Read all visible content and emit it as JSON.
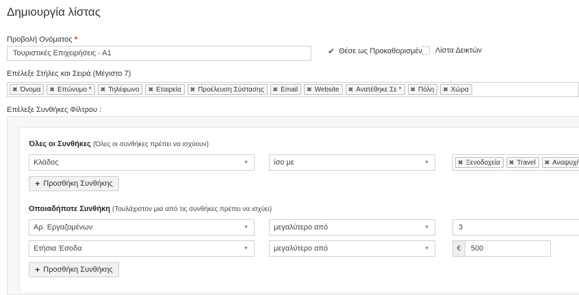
{
  "page": {
    "title": "Δημιουργία λίστας"
  },
  "name_field": {
    "label": "Προβολή Ονόματος",
    "required_mark": "*",
    "value": "Τουριστικές Επιχειρήσεις - Α1"
  },
  "options": {
    "default_label": "Θέσε ως Προκαθορισμένο",
    "default_checked": true,
    "index_label": "Λίστα Δεικτών",
    "index_checked": false
  },
  "columns": {
    "label": "Επέλεξε Στήλες και Σειρά (Μέγιστο 7)",
    "tags": [
      "Όνομα",
      "Επώνυμο *",
      "Τηλέφωνο",
      "Εταιρεία",
      "Προέλευση Σύστασης",
      "Email",
      "Website",
      "Ανατέθηκε Σε *",
      "Πόλη",
      "Χώρα"
    ]
  },
  "filters": {
    "label": "Επέλεξε Συνθήκες Φίλτρου :",
    "all": {
      "title": "Όλες οι Συνθήκες",
      "subtitle": "(Όλες οι συνθήκες πρέπει να ισχύουν)",
      "field": "Κλάδος",
      "operator": "ίσο με",
      "value_tags": [
        "Ξενοδοχεία",
        "Travel",
        "Αναψυχή"
      ],
      "add_button": "Προσθήκη Συνθήκης"
    },
    "any": {
      "title": "Οποιαδήποτε Συνθήκη",
      "subtitle": "(Τουλάχιστον μια από τις συνθήκες πρέπει να ισχύει)",
      "rows": [
        {
          "field": "Αρ. Εργαζομένων",
          "operator": "μεγαλύτερο από",
          "value": "3"
        },
        {
          "field": "Ετήσια Έσοδα",
          "operator": "μεγαλύτερο από",
          "currency": "€",
          "value": "500"
        }
      ],
      "add_button": "Προσθήκη Συνθήκης"
    }
  },
  "icons": {
    "remove": "close-icon",
    "dropdown": "triangle-down-icon",
    "add": "plus-icon",
    "check": "checkmark-icon"
  }
}
